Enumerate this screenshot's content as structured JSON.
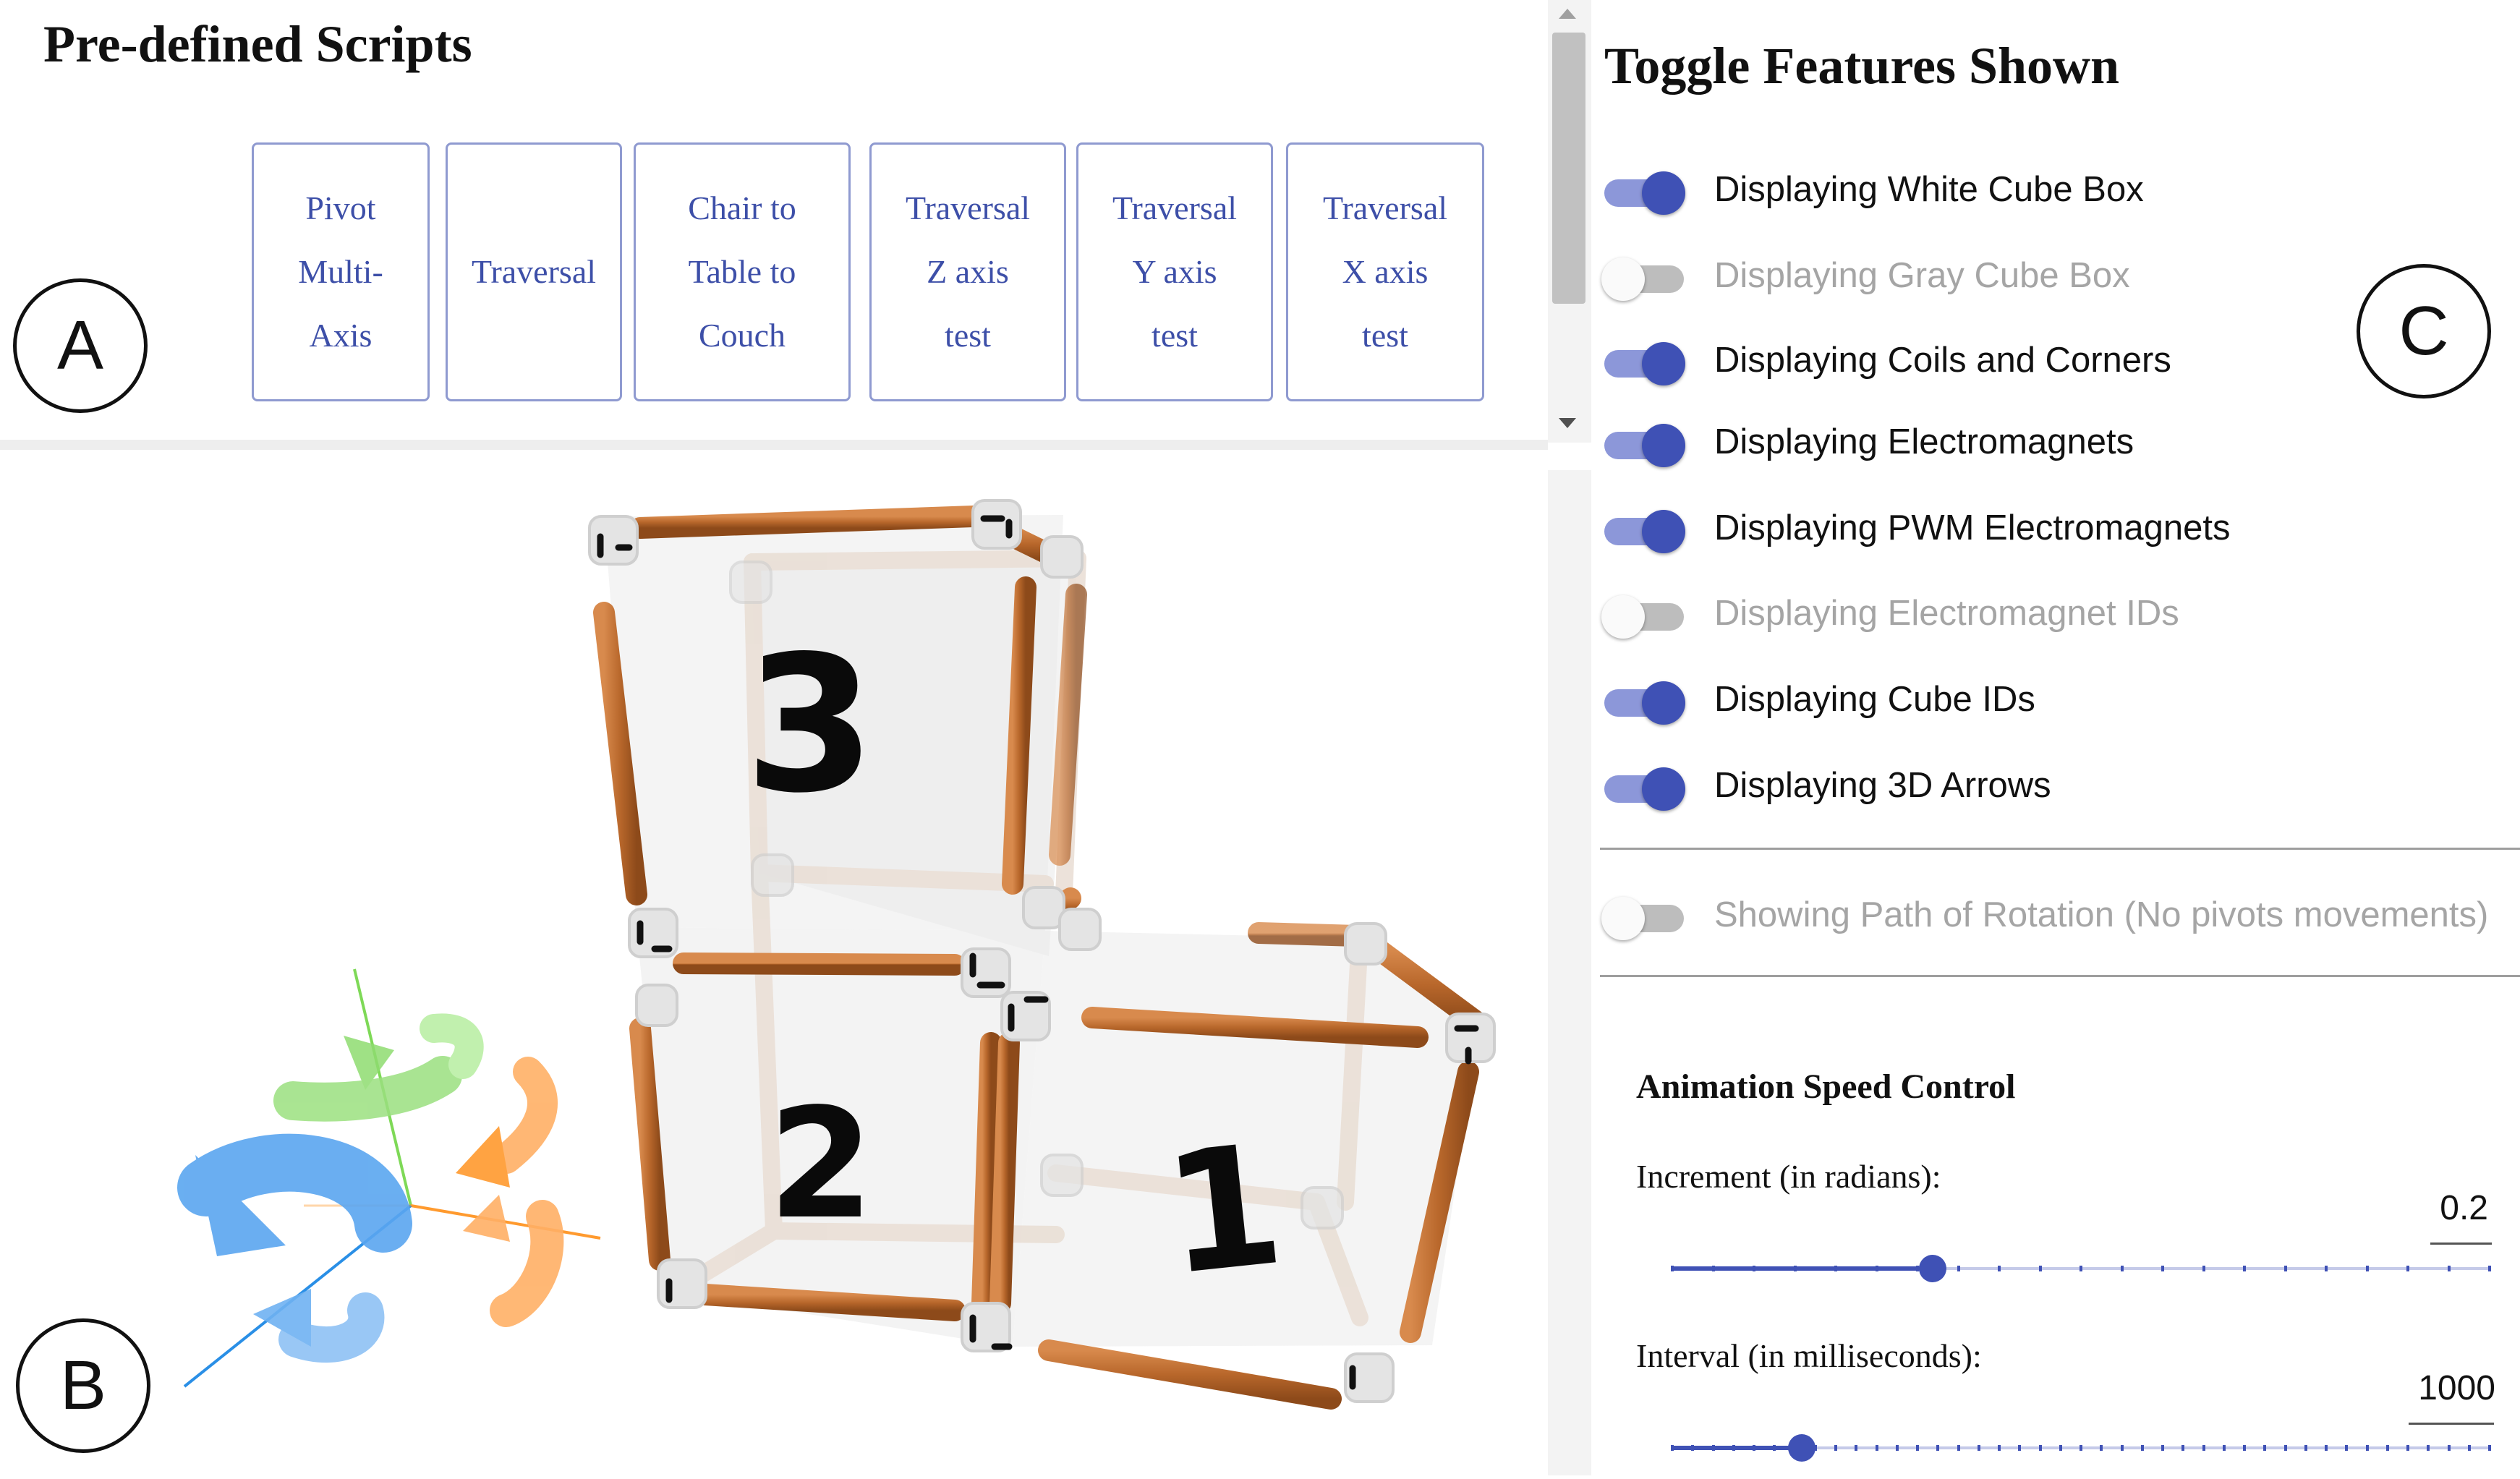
{
  "scripts": {
    "title": "Pre-defined Scripts",
    "buttons": [
      {
        "label": "Pivot\nMulti-\nAxis"
      },
      {
        "label": "Traversal"
      },
      {
        "label": "Chair to\nTable to\nCouch"
      },
      {
        "label": "Traversal\nZ axis\ntest"
      },
      {
        "label": "Traversal\nY axis\ntest"
      },
      {
        "label": "Traversal\nX axis\ntest"
      }
    ]
  },
  "annotations": {
    "a": "A",
    "b": "B",
    "c": "C"
  },
  "viewport": {
    "cube_ids": [
      "1",
      "2",
      "3"
    ],
    "colors": {
      "frame": "#b8672b",
      "axis_x": "#ff9a2e",
      "axis_y": "#7ed957",
      "axis_z": "#2a8fe6"
    },
    "arrow_icons": [
      "rotate-x-arrow-icon",
      "rotate-y-arrow-icon",
      "rotate-z-arrow-icon"
    ]
  },
  "toggles": {
    "title": "Toggle Features Shown",
    "items": [
      {
        "label": "Displaying White Cube Box",
        "on": true
      },
      {
        "label": "Displaying Gray Cube Box",
        "on": false
      },
      {
        "label": "Displaying Coils and Corners",
        "on": true
      },
      {
        "label": "Displaying Electromagnets",
        "on": true
      },
      {
        "label": "Displaying PWM Electromagnets",
        "on": true
      },
      {
        "label": "Displaying Electromagnet IDs",
        "on": false
      },
      {
        "label": "Displaying Cube IDs",
        "on": true
      },
      {
        "label": "Displaying 3D Arrows",
        "on": true
      }
    ],
    "path": {
      "label": "Showing Path of Rotation (No pivots movements)",
      "on": false
    }
  },
  "animation": {
    "title": "Animation Speed Control",
    "increment": {
      "label": "Increment (in radians):",
      "value": "0.2",
      "fraction": 0.32
    },
    "interval": {
      "label": "Interval (in milliseconds):",
      "value": "1000",
      "fraction": 0.16
    }
  },
  "colors": {
    "accent": "#3f51b5",
    "accent_light": "#8c97d9",
    "button_text": "#3d4fa8"
  }
}
